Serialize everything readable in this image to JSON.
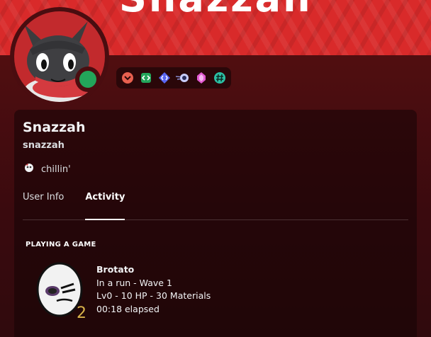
{
  "banner": {
    "text": "Snazzah"
  },
  "profile": {
    "display_name": "Snazzah",
    "username": "snazzah",
    "status_text": "chillin'",
    "online_status": "online",
    "status_color": "#23a55a"
  },
  "badges": [
    {
      "icon": "nitro-boost-icon",
      "color": "#e8604f"
    },
    {
      "icon": "code-badge-icon",
      "color": "#23a55a"
    },
    {
      "icon": "active-developer-icon",
      "color": "#5865f2"
    },
    {
      "icon": "orb-icon",
      "color": "#c9cdfb"
    },
    {
      "icon": "gem-icon",
      "color": "#e25ad1"
    },
    {
      "icon": "hashtag-icon",
      "color": "#2bbfa3"
    }
  ],
  "tabs": [
    {
      "label": "User Info",
      "active": false
    },
    {
      "label": "Activity",
      "active": true
    }
  ],
  "activity": {
    "section_title": "PLAYING A GAME",
    "game_name": "Brotato",
    "details": "In a run - Wave 1",
    "state": "Lv0 - 10 HP - 30 Materials",
    "elapsed": "00:18 elapsed",
    "small_image_text": "2"
  },
  "colors": {
    "banner": "#d92a2a",
    "background": "#4a0d10",
    "accent_green": "#23a55a"
  }
}
